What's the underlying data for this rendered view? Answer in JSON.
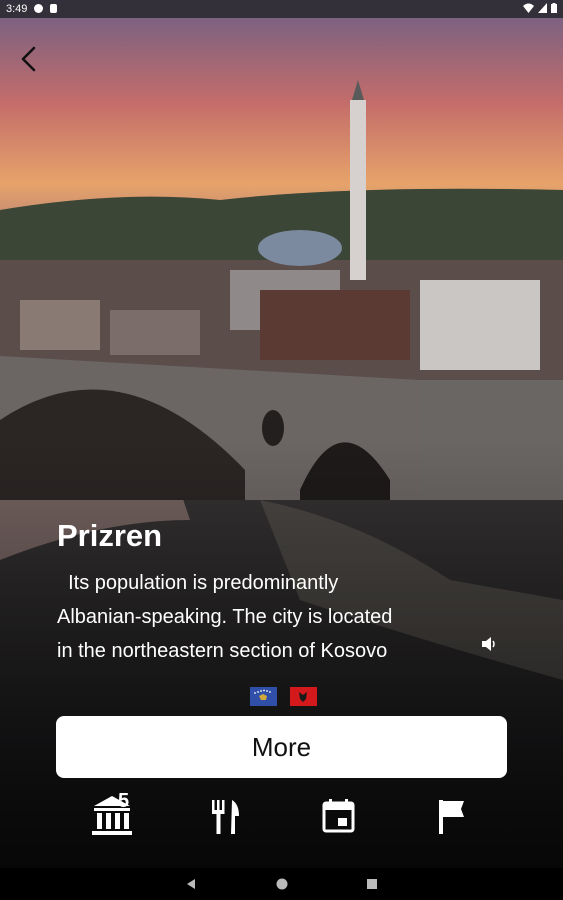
{
  "status_bar": {
    "time": "3:49",
    "icons": [
      "app-notification-icon",
      "sim-icon",
      "wifi-icon",
      "signal-icon",
      "battery-icon"
    ]
  },
  "place": {
    "title": "Prizren",
    "description_lines": [
      "  Its population is predominantly",
      "Albanian-speaking. The city is located",
      "in the northeastern section of Kosovo"
    ]
  },
  "flags": [
    "kosovo-flag",
    "albania-flag"
  ],
  "more_button": {
    "label": "More"
  },
  "bottom_nav": [
    {
      "icon": "museum-icon",
      "badge": "5"
    },
    {
      "icon": "restaurant-icon"
    },
    {
      "icon": "calendar-icon"
    },
    {
      "icon": "flag-icon"
    }
  ],
  "colors": {
    "button_bg": "#ffffff",
    "text": "#ffffff",
    "kosovo": "#2f4fa8",
    "albania": "#d3191c"
  }
}
